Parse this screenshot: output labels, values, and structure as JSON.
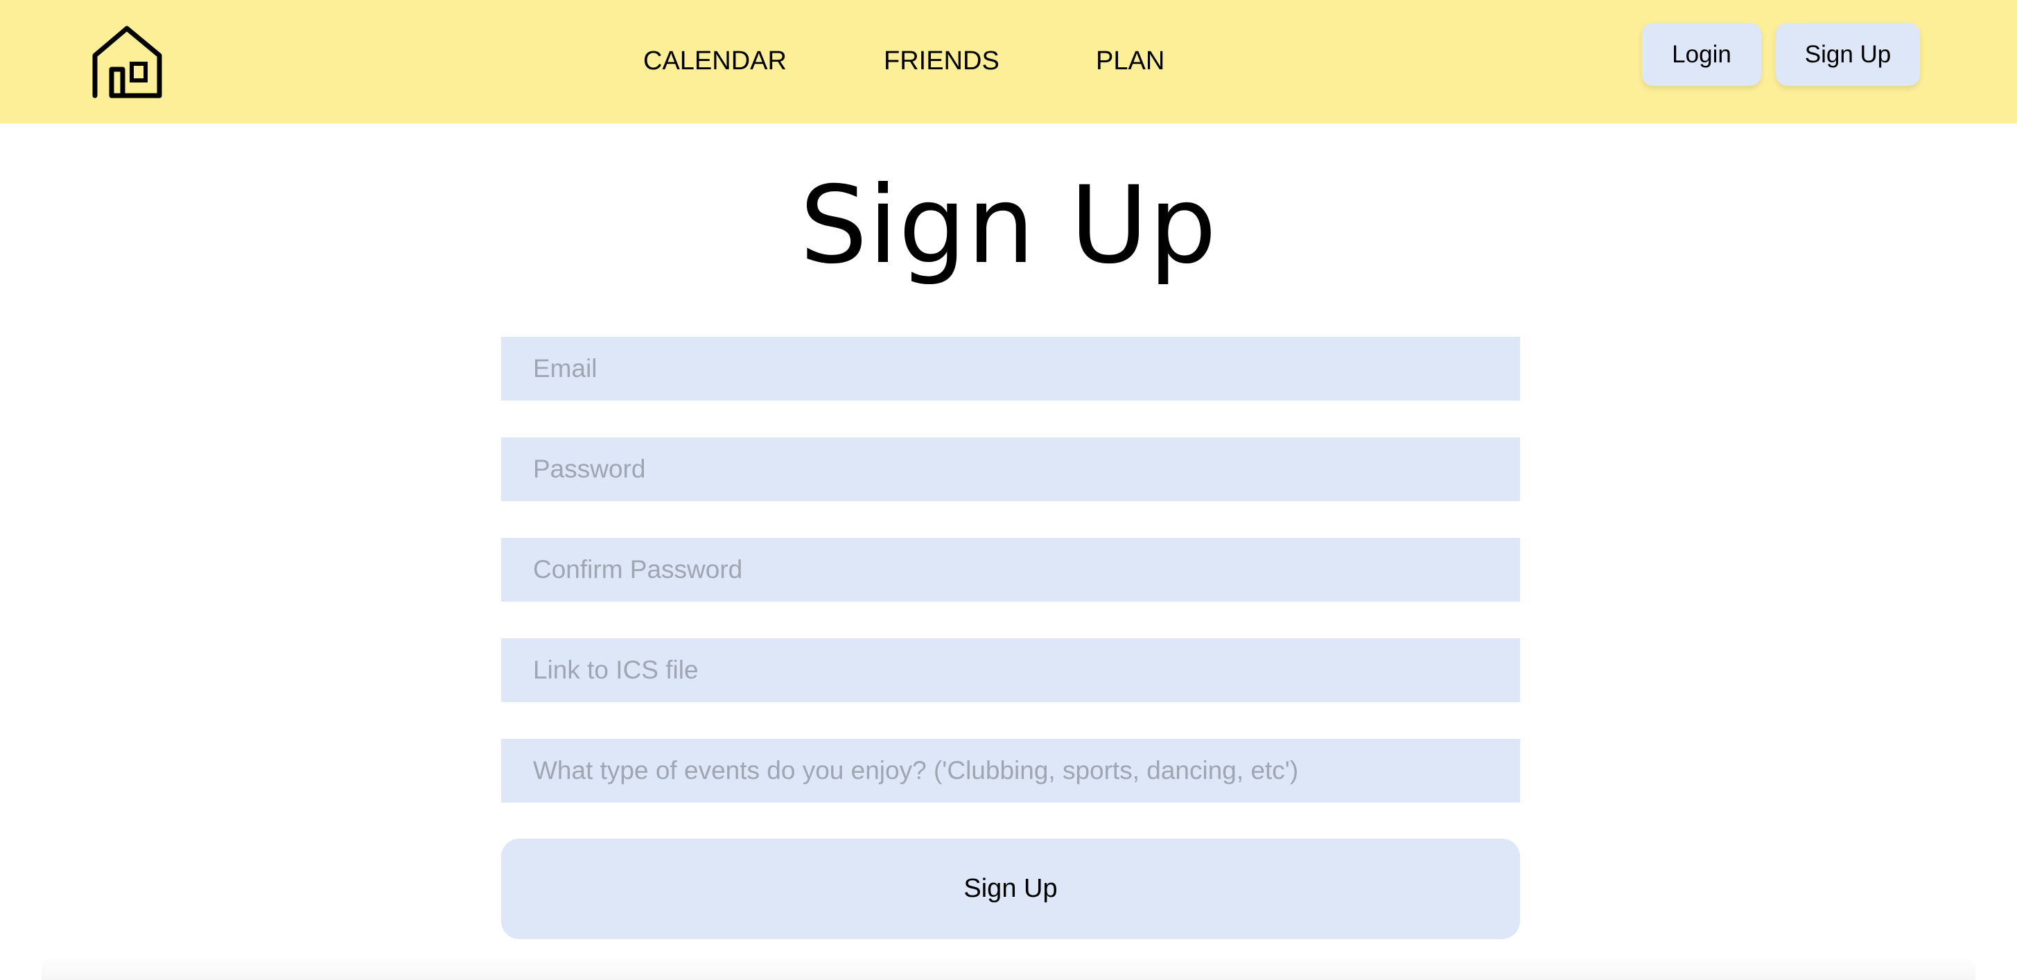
{
  "header": {
    "logo_icon": "house-icon",
    "nav": {
      "calendar": "CALENDAR",
      "friends": "FRIENDS",
      "plan": "PLAN"
    },
    "login_label": "Login",
    "signup_label": "Sign Up"
  },
  "page": {
    "title": "Sign Up"
  },
  "form": {
    "email": {
      "placeholder": "Email",
      "value": ""
    },
    "password": {
      "placeholder": "Password",
      "value": ""
    },
    "confirm_password": {
      "placeholder": "Confirm Password",
      "value": ""
    },
    "ics_link": {
      "placeholder": "Link to ICS file",
      "value": ""
    },
    "events": {
      "placeholder": "What type of events do you enjoy? ('Clubbing, sports, dancing, etc')",
      "value": ""
    },
    "submit_label": "Sign Up"
  },
  "colors": {
    "header_background": "#fdef98",
    "field_background": "#dee7f8",
    "placeholder_text": "#9ea6b1"
  }
}
